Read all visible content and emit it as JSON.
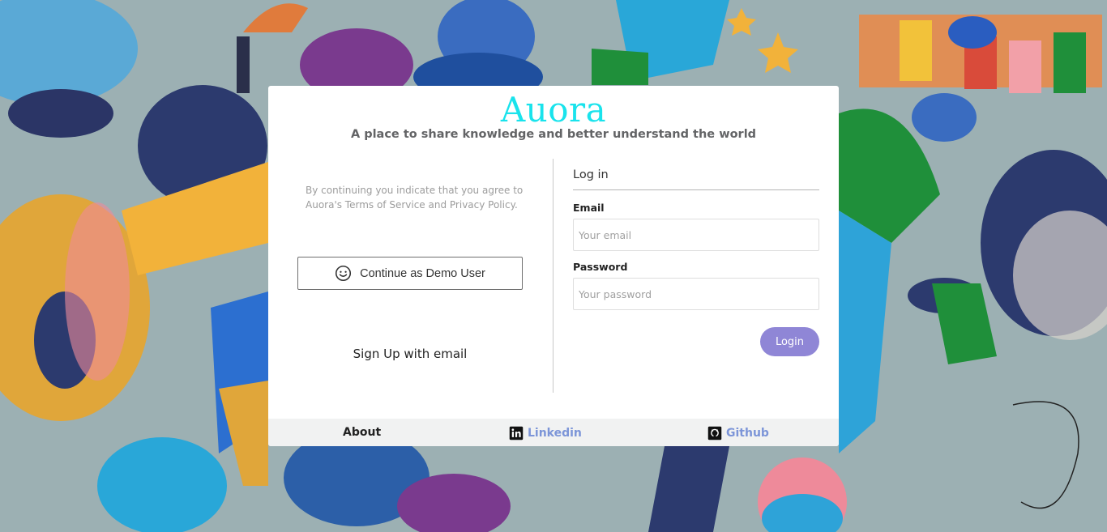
{
  "brand": {
    "logo": "Auora",
    "tagline": "A place to share knowledge and better understand the world"
  },
  "left": {
    "terms": "By continuing you indicate that you agree to Auora's Terms of Service and Privacy Policy.",
    "demo_button": {
      "label": "Continue as Demo User",
      "icon": "smiley-icon"
    },
    "signup": "Sign Up with email"
  },
  "login": {
    "title": "Log in",
    "email_label": "Email",
    "email_placeholder": "Your email",
    "email_value": "",
    "password_label": "Password",
    "password_placeholder": "Your password",
    "password_value": "",
    "button": "Login"
  },
  "footer": {
    "about": "About",
    "linkedin": {
      "label": "Linkedin",
      "icon": "linkedin-icon"
    },
    "github": {
      "label": "Github",
      "icon": "github-icon"
    }
  },
  "colors": {
    "logo": "#19e3ec",
    "login_button": "#8f86d6",
    "footer_link": "#7c95d8",
    "footer_bg": "#f1f2f2"
  }
}
